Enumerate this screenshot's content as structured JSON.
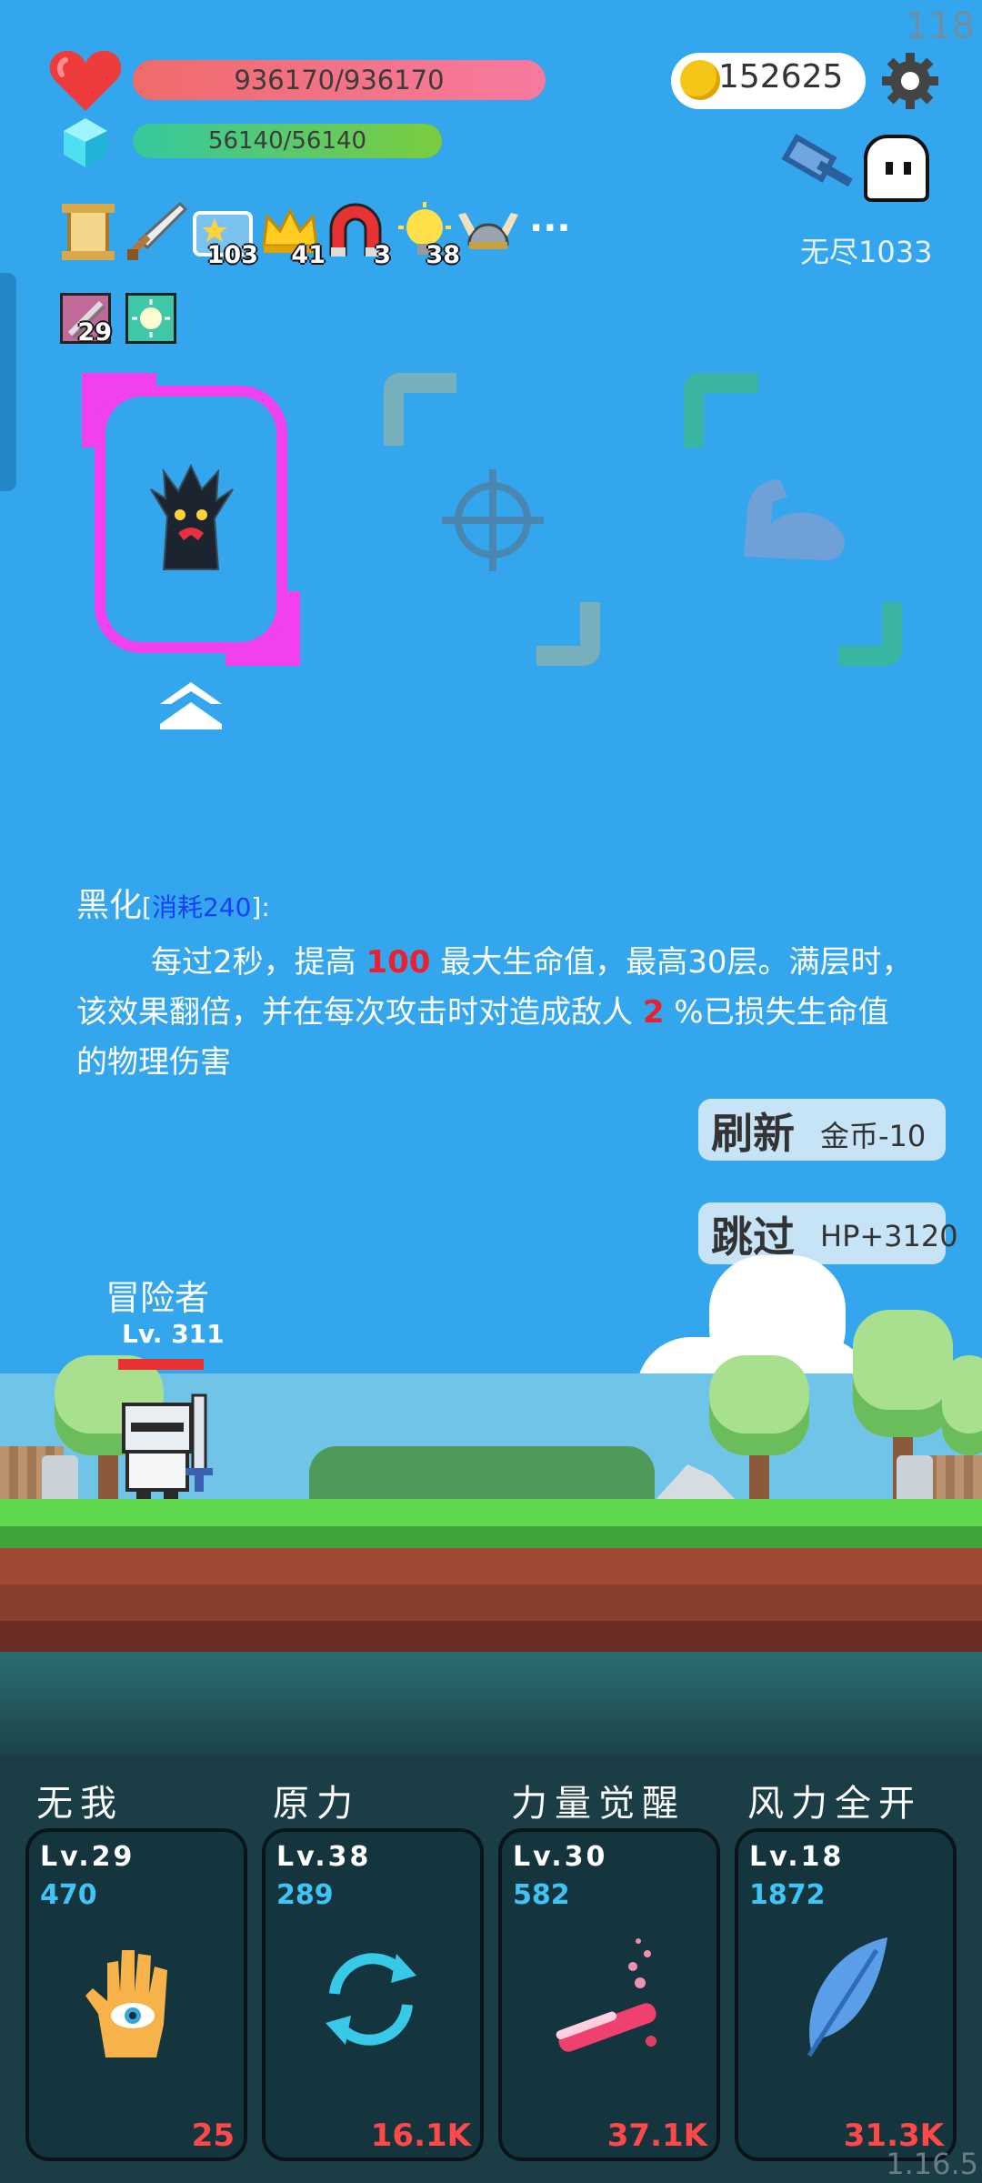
{
  "hud": {
    "fps": "118",
    "hp": "936170/936170",
    "hp_fraction": 1.0,
    "mp": "56140/56140",
    "mp_fraction": 1.0,
    "coins": "152625",
    "endless_stage": "无尽1033",
    "buffs": [
      {
        "icon": "scroll-icon",
        "count": ""
      },
      {
        "icon": "sword-icon",
        "count": ""
      },
      {
        "icon": "star-card-icon",
        "count": "103"
      },
      {
        "icon": "crown-icon",
        "count": "41"
      },
      {
        "icon": "magnet-icon",
        "count": "3"
      },
      {
        "icon": "lightbulb-icon",
        "count": "38"
      },
      {
        "icon": "viking-helmet-icon",
        "count": ""
      },
      {
        "icon": "more-icon",
        "count": "···"
      }
    ],
    "buffs2": [
      {
        "icon": "pickaxe-icon",
        "count": "29"
      },
      {
        "icon": "glow-icon",
        "count": ""
      }
    ]
  },
  "cards": {
    "selected_icon": "dark-tree-monster-icon",
    "option2_icon": "crosshair-icon",
    "option3_icon": "flexed-arm-icon"
  },
  "description": {
    "name": "黑化",
    "cost_open": "[",
    "cost": "消耗240",
    "cost_close": "]:",
    "line1_a": "每过2秒，提高 ",
    "line1_red": "100",
    "line1_b": " 最大生命值，最高30层。满层时，该效果翻倍，并在每次攻击时对造成敌人 ",
    "line1_red2": "2",
    "line1_c": " %已损失生命值的物理伤害"
  },
  "actions": {
    "refresh_label": "刷新",
    "refresh_cost": "金币-10",
    "skip_label": "跳过",
    "skip_reward": "HP+3120"
  },
  "player": {
    "name": "冒险者",
    "level": "Lv. 311"
  },
  "skills": [
    {
      "title": "无我",
      "lv": "Lv.29",
      "value": "470",
      "cost": "25",
      "icon": "hand-eye-icon"
    },
    {
      "title": "原力",
      "lv": "Lv.38",
      "value": "289",
      "cost": "16.1K",
      "icon": "refresh-cycle-icon"
    },
    {
      "title": "力量觉醒",
      "lv": "Lv.30",
      "value": "582",
      "cost": "37.1K",
      "icon": "test-tube-icon"
    },
    {
      "title": "风力全开",
      "lv": "Lv.18",
      "value": "1872",
      "cost": "31.3K",
      "icon": "feather-icon"
    }
  ],
  "version": "1.16.5",
  "colors": {
    "sky": "#33a6ee",
    "hp_bar": "#f07180",
    "mp_bar": "#3fc080",
    "selected_frame": "#f040f0",
    "skill_panel": "#1b3d46"
  }
}
